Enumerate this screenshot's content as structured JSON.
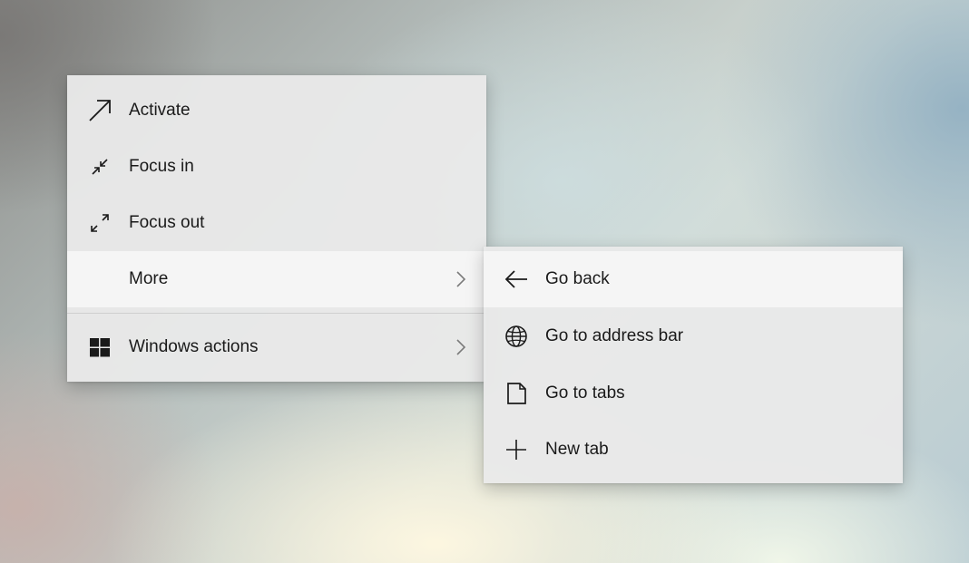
{
  "context_menu": {
    "items": [
      {
        "label": "Activate",
        "icon": "arrow-up-right-icon"
      },
      {
        "label": "Focus in",
        "icon": "focus-in-icon"
      },
      {
        "label": "Focus out",
        "icon": "focus-out-icon"
      },
      {
        "label": "More",
        "icon": "",
        "has_submenu": true,
        "highlighted": true
      },
      {
        "label": "Windows actions",
        "icon": "windows-logo-icon",
        "has_submenu": true
      }
    ]
  },
  "submenu": {
    "items": [
      {
        "label": "Go back",
        "icon": "arrow-left-icon",
        "highlighted": true
      },
      {
        "label": "Go to address bar",
        "icon": "globe-icon"
      },
      {
        "label": "Go to tabs",
        "icon": "page-icon"
      },
      {
        "label": "New tab",
        "icon": "plus-icon"
      }
    ]
  },
  "colors": {
    "menu_background": "#e9e9e9",
    "highlight_background": "#f5f5f5",
    "text": "#1a1a1a",
    "chevron": "#7a7a7a"
  }
}
